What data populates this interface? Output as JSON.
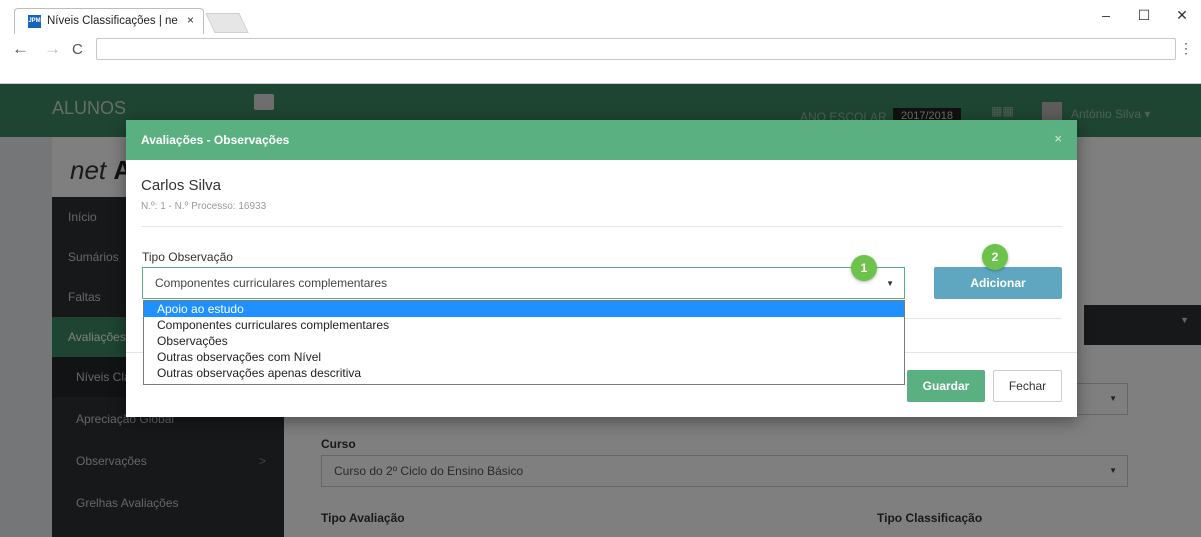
{
  "browser": {
    "tab_title": "Níveis Classificações | ne",
    "tab_close": "×",
    "favicon_text": "JPM",
    "window_buttons": [
      "–",
      "☐",
      "✕"
    ],
    "nav": {
      "back": "←",
      "forward": "→",
      "reload": "C",
      "menu": "⋮"
    },
    "address": ""
  },
  "app": {
    "brand": "ALUNOS",
    "ano_escolar_label": "ANO ESCOLAR",
    "ano_escolar_value": "2017/2018",
    "user_name": "António Silva ▾",
    "logo_prefix": "net",
    "logo_bold": "A",
    "sidebar": {
      "items": [
        {
          "label": "Início"
        },
        {
          "label": "Sumários"
        },
        {
          "label": "Faltas"
        },
        {
          "label": "Avaliações"
        },
        {
          "label": "Níveis Clas"
        },
        {
          "label": "Apreciação Global"
        },
        {
          "label": "Observações",
          "arrow": ">"
        },
        {
          "label": "Grelhas Avaliações"
        }
      ]
    },
    "content": {
      "curso_label": "Curso",
      "curso_value": "Curso do 2º Ciclo do Ensino Básico",
      "tipo_avaliacao_label": "Tipo Avaliação",
      "tipo_classificacao_label": "Tipo Classificação"
    }
  },
  "modal": {
    "title": "Avaliações - Observações",
    "close": "×",
    "student_name": "Carlos Silva",
    "student_info": "N.º: 1 - N.º Processo: 16933",
    "field_label": "Tipo Observação",
    "select_value": "Componentes curriculares complementares",
    "add_button": "Adicionar",
    "save_button": "Guardar",
    "close_button": "Fechar",
    "markers": [
      "1",
      "2"
    ],
    "dropdown_options": [
      "Apoio ao estudo",
      "Componentes curriculares complementares",
      "Observações",
      "Outras observações com Nível",
      "Outras observações apenas descritiva"
    ],
    "highlighted_option_index": 0
  },
  "colors": {
    "header_green": "#3c8a65",
    "modal_header": "#5bb082",
    "add_button": "#5fa7c1",
    "marker": "#6cc24a",
    "option_highlight": "#1e90ff",
    "sidebar_bg": "#2c3034"
  }
}
